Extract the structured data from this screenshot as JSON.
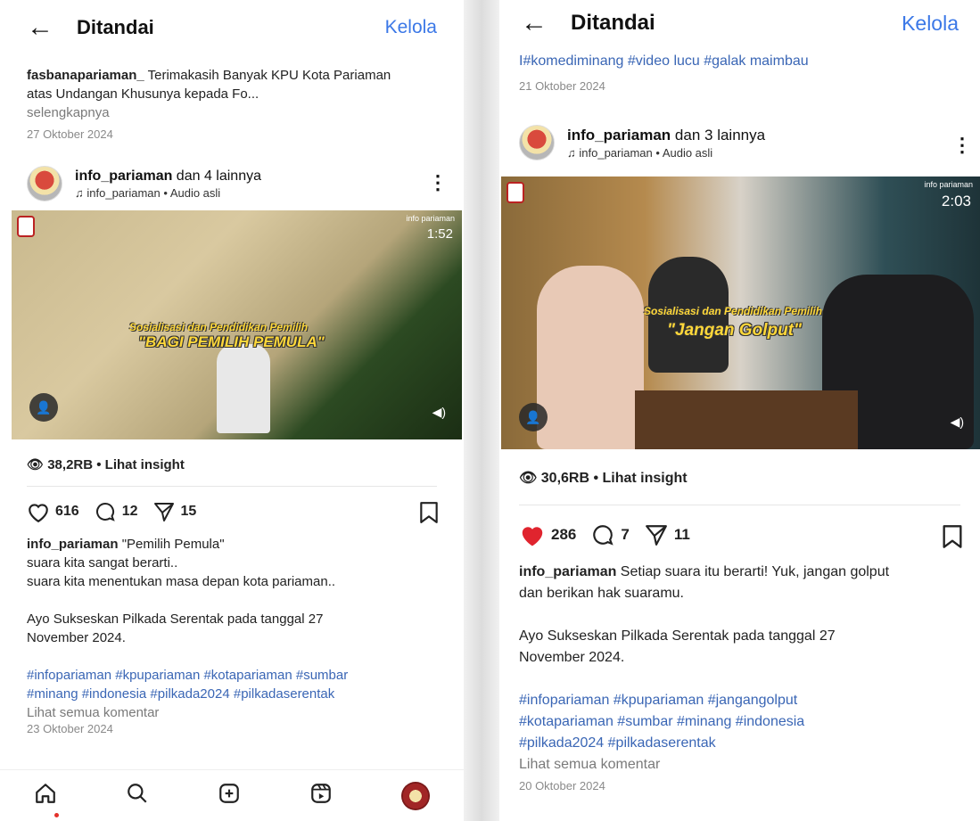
{
  "left": {
    "header": {
      "back": "←",
      "title": "Ditandai",
      "manage": "Kelola"
    },
    "prev_caption": {
      "user": "fasbanapariaman_",
      "text": " Terimakasih Banyak KPU Kota Pariaman atas Undangan Khusunya kepada Fo...",
      "more": "selengkapnya",
      "date": "27 Oktober 2024"
    },
    "post": {
      "user": "info_pariaman",
      "others": " dan 4 lainnya",
      "audio": "info_pariaman • Audio asli",
      "video": {
        "watermark": "info pariaman",
        "duration": "1:52",
        "subtitle_small": "Sosialisasi dan Pendidikan Pemilih",
        "subtitle_big": "\"BAGI PEMILIH PEMULA\""
      },
      "insight": "38,2RB • Lihat insight",
      "likes": "616",
      "comments": "12",
      "shares": "15",
      "caption_user": "info_pariaman",
      "caption_lines": [
        " \"Pemilih Pemula\"",
        "suara kita sangat berarti..",
        "suara kita menentukan masa depan kota pariaman..",
        "",
        "Ayo Sukseskan Pilkada Serentak pada tanggal 27",
        "November 2024.",
        ""
      ],
      "hashtags": [
        "#infopariaman #kpupariaman #kotapariaman #sumbar",
        "#minang #indonesia #pilkada2024 #pilkadaserentak"
      ],
      "all_comments": "Lihat semua komentar",
      "date": "23 Oktober 2024"
    },
    "nav": [
      "home-icon",
      "search-icon",
      "create-icon",
      "reels-icon",
      "profile-icon"
    ]
  },
  "right": {
    "header": {
      "back": "←",
      "title": "Ditandai",
      "manage": "Kelola"
    },
    "prev_caption": {
      "text": "I#komediminang #video lucu #galak maimbau",
      "date": "21 Oktober 2024"
    },
    "post": {
      "user": "info_pariaman",
      "others": " dan 3 lainnya",
      "audio": "info_pariaman • Audio asli",
      "video": {
        "watermark": "info pariaman",
        "duration": "2:03",
        "subtitle_small": "Sosialisasi dan Pendidikan Pemilih",
        "subtitle_big": "\"Jangan Golput\""
      },
      "insight": "30,6RB • Lihat insight",
      "likes": "286",
      "comments": "7",
      "shares": "11",
      "caption_user": "info_pariaman",
      "caption_lines": [
        " Setiap suara itu berarti! Yuk, jangan golput",
        "dan berikan hak suaramu.",
        "",
        "Ayo Sukseskan Pilkada Serentak pada tanggal 27",
        "November 2024.",
        ""
      ],
      "hashtags": [
        "#infopariaman #kpupariaman #jangangolput",
        "#kotapariaman #sumbar #minang #indonesia",
        "#pilkada2024 #pilkadaserentak"
      ],
      "all_comments": "Lihat semua komentar",
      "date": "20 Oktober 2024"
    }
  },
  "colors": {
    "accent": "#3b78e7",
    "like_red": "#e0242e",
    "hashtag": "#3a66b5"
  }
}
